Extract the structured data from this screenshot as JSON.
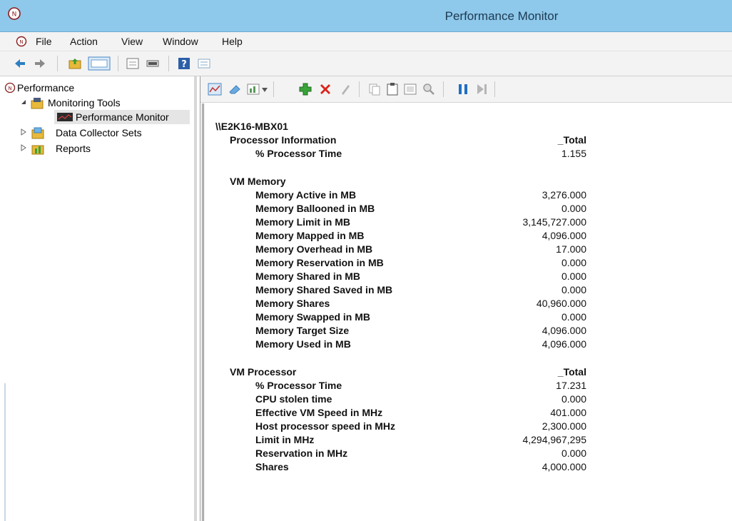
{
  "window": {
    "title": "Performance Monitor"
  },
  "menu": [
    "File",
    "Action",
    "View",
    "Window",
    "Help"
  ],
  "tree": {
    "root": "Performance",
    "monitoring_tools": "Monitoring Tools",
    "performance_monitor": "Performance Monitor",
    "data_collector_sets": "Data Collector Sets",
    "reports": "Reports"
  },
  "report": {
    "machine": "\\\\E2K16-MBX01",
    "sections": [
      {
        "object": "Processor Information",
        "instance": "_Total",
        "counters": [
          {
            "name": "% Processor Time",
            "value": "1.155"
          }
        ]
      },
      {
        "object": "VM Memory",
        "instance": "",
        "counters": [
          {
            "name": "Memory Active in MB",
            "value": "3,276.000"
          },
          {
            "name": "Memory Ballooned in MB",
            "value": "0.000"
          },
          {
            "name": "Memory Limit in MB",
            "value": "3,145,727.000"
          },
          {
            "name": "Memory Mapped in MB",
            "value": "4,096.000"
          },
          {
            "name": "Memory Overhead in MB",
            "value": "17.000"
          },
          {
            "name": "Memory Reservation in MB",
            "value": "0.000"
          },
          {
            "name": "Memory Shared in MB",
            "value": "0.000"
          },
          {
            "name": "Memory Shared Saved in MB",
            "value": "0.000"
          },
          {
            "name": "Memory Shares",
            "value": "40,960.000"
          },
          {
            "name": "Memory Swapped in MB",
            "value": "0.000"
          },
          {
            "name": "Memory Target Size",
            "value": "4,096.000"
          },
          {
            "name": "Memory Used in MB",
            "value": "4,096.000"
          }
        ]
      },
      {
        "object": "VM Processor",
        "instance": "_Total",
        "counters": [
          {
            "name": "% Processor Time",
            "value": "17.231"
          },
          {
            "name": "CPU stolen time",
            "value": "0.000"
          },
          {
            "name": "Effective VM Speed in MHz",
            "value": "401.000"
          },
          {
            "name": "Host processor speed in MHz",
            "value": "2,300.000"
          },
          {
            "name": "Limit in MHz",
            "value": "4,294,967,295"
          },
          {
            "name": "Reservation in MHz",
            "value": "0.000"
          },
          {
            "name": "Shares",
            "value": "4,000.000"
          }
        ]
      }
    ]
  },
  "icons": {
    "app": "perfmon-gauge-icon",
    "toolbar": [
      "back-arrow-icon",
      "forward-arrow-icon",
      "up-folder-icon",
      "show-hide-tree-icon",
      "properties-icon",
      "console-icon",
      "help-icon",
      "mmc-icon"
    ],
    "right_toolbar": [
      "view-graph-icon",
      "clear-display-icon",
      "change-graph-type-icon",
      "add-counter-icon",
      "delete-counter-icon",
      "highlight-icon",
      "copy-properties-icon",
      "paste-counter-list-icon",
      "properties-icon",
      "zoom-icon",
      "freeze-display-icon",
      "update-data-icon"
    ]
  },
  "colors": {
    "titlebar": "#8ec8ea",
    "add": "#3aa33a",
    "delete": "#d9241b",
    "pause": "#1f6fc4"
  }
}
